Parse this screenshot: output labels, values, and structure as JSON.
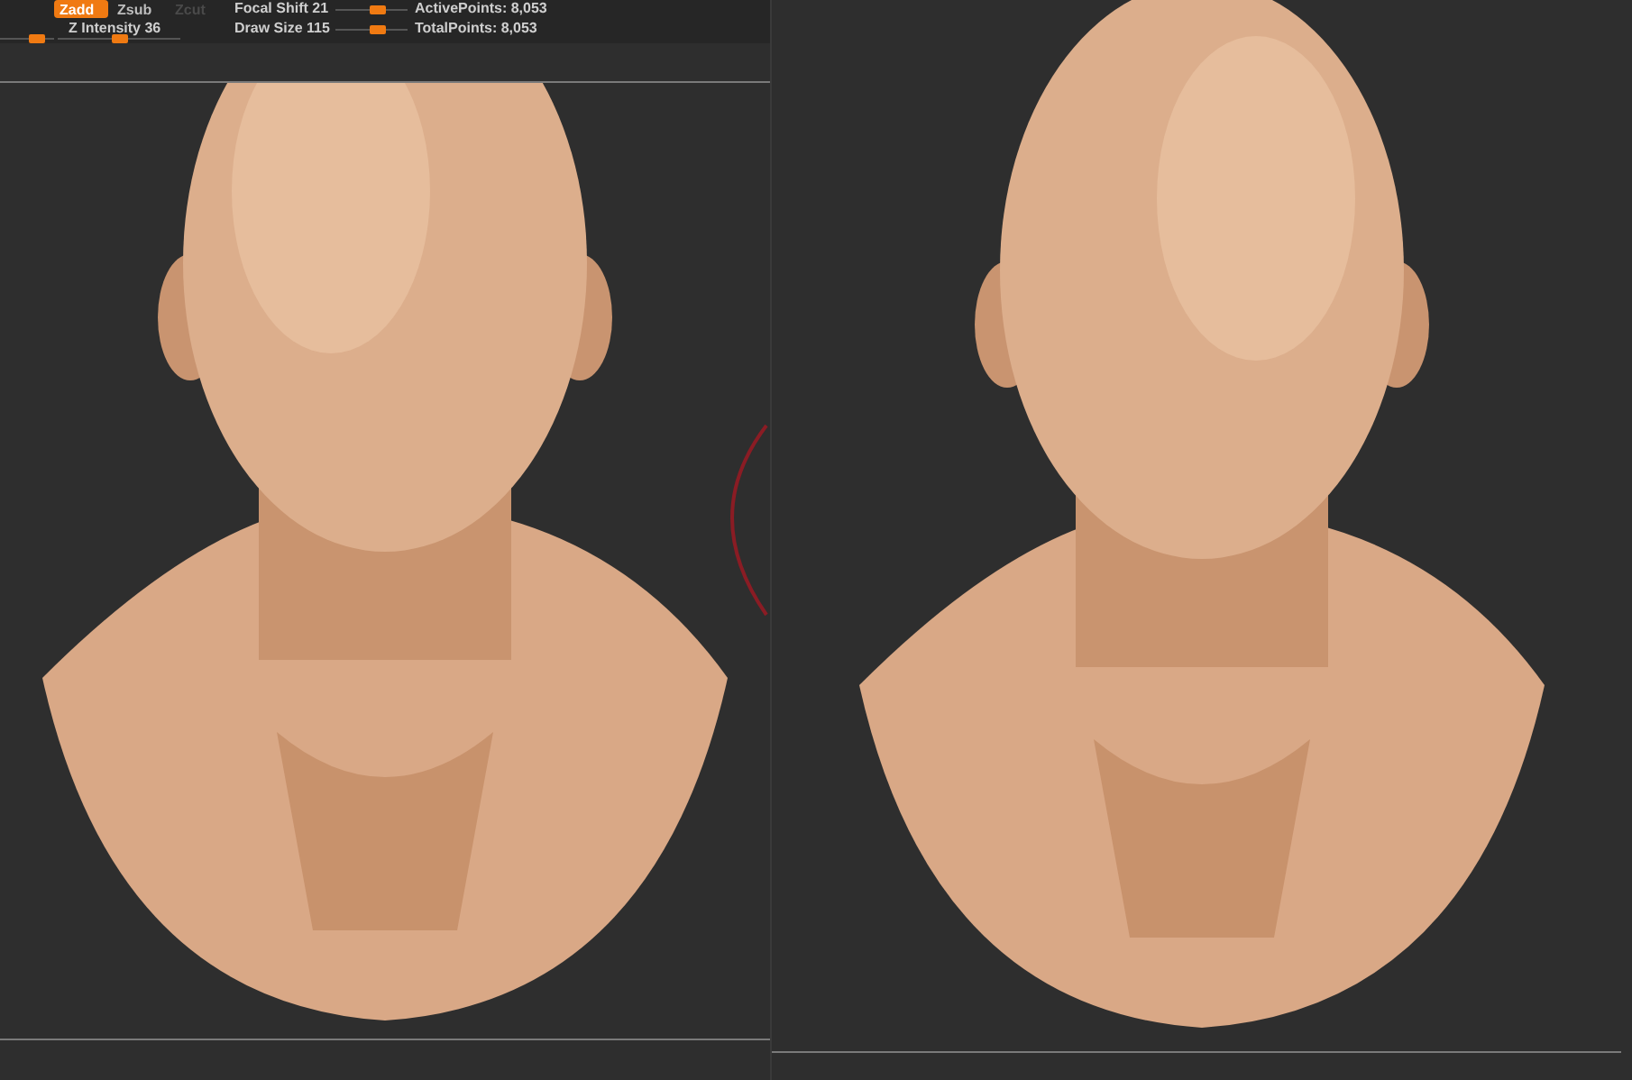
{
  "toolbar": {
    "buttons": [
      {
        "label": "Zadd",
        "selected": true,
        "disabled": false
      },
      {
        "label": "Zsub",
        "selected": false,
        "disabled": false
      },
      {
        "label": "Zcut",
        "selected": false,
        "disabled": true
      }
    ],
    "sliders": [
      {
        "label": "Focal Shift 21",
        "level": 0.6
      },
      {
        "label": "Z Intensity 36",
        "level": 0.5
      },
      {
        "label": "Draw Size 115",
        "level": 0.6
      }
    ],
    "left_slider": {
      "level": 0.75
    },
    "stats": [
      "ActivePoints: 8,053",
      "TotalPoints: 8,053"
    ]
  }
}
